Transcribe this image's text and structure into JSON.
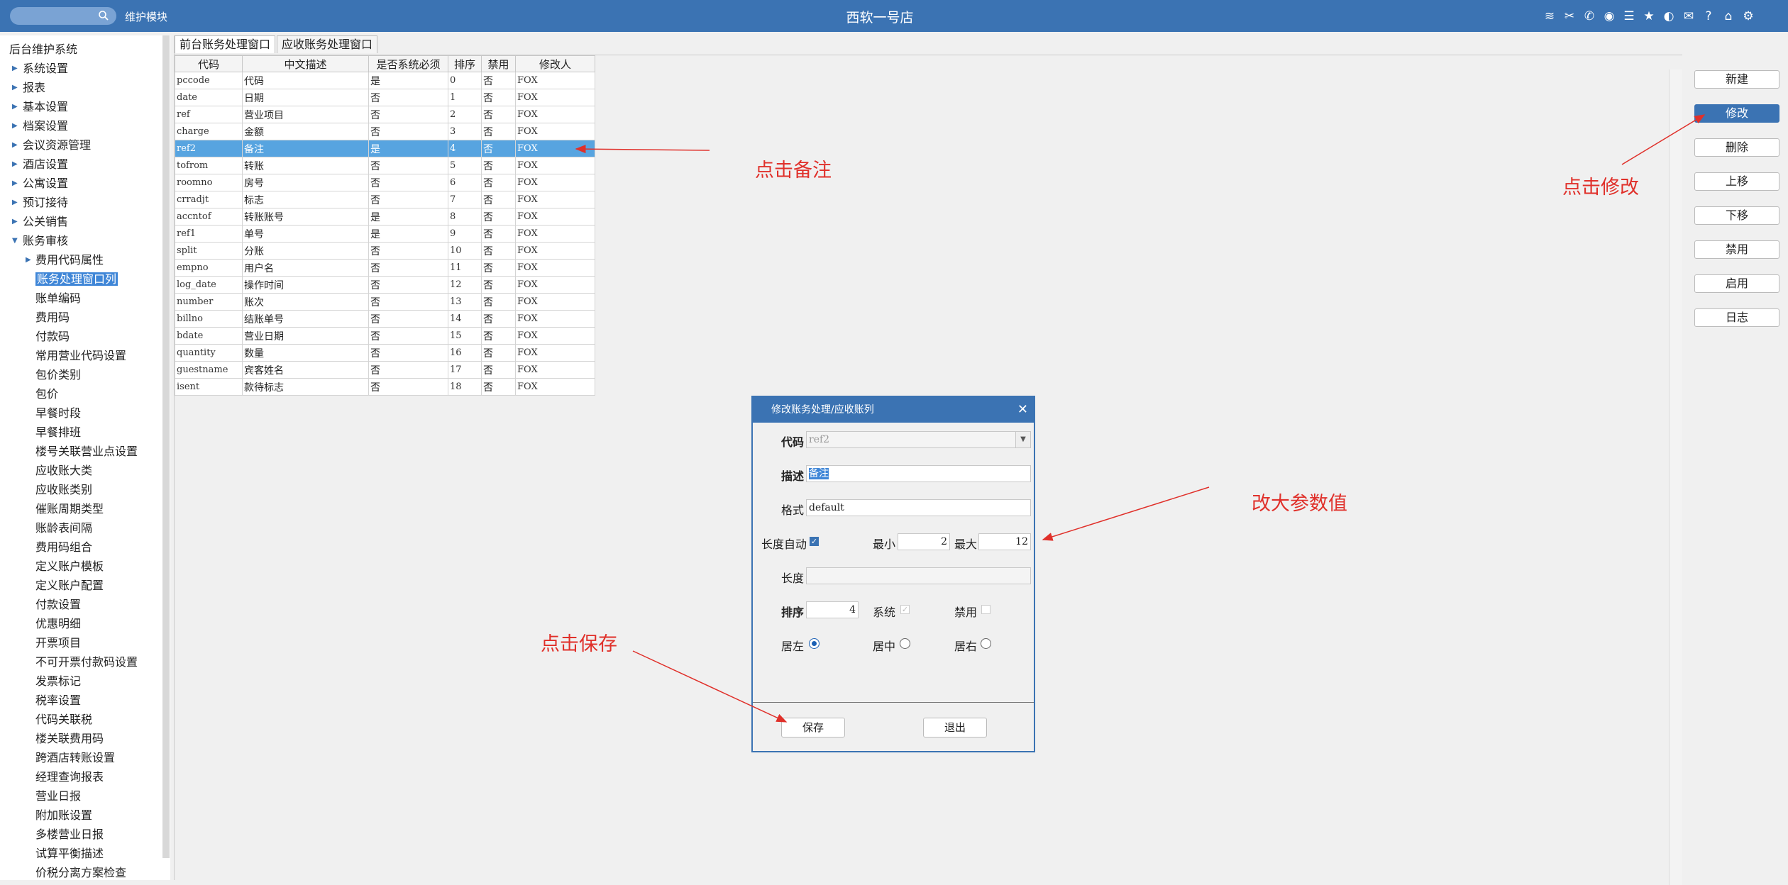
{
  "topbar": {
    "module": "维护模块",
    "title": "西软一号店"
  },
  "top_icons": [
    "wifi-icon",
    "tools-icon",
    "phone-icon",
    "palette-icon",
    "menu-icon",
    "star-icon",
    "contrast-icon",
    "mail-icon",
    "help-icon",
    "home-icon",
    "gear-icon"
  ],
  "sidebar": {
    "items": [
      {
        "label": "后台维护系统",
        "level": 0,
        "arrow": ""
      },
      {
        "label": "系统设置",
        "level": 1,
        "arrow": "▶"
      },
      {
        "label": "报表",
        "level": 1,
        "arrow": "▶"
      },
      {
        "label": "基本设置",
        "level": 1,
        "arrow": "▶"
      },
      {
        "label": "档案设置",
        "level": 1,
        "arrow": "▶"
      },
      {
        "label": "会议资源管理",
        "level": 1,
        "arrow": "▶"
      },
      {
        "label": "酒店设置",
        "level": 1,
        "arrow": "▶"
      },
      {
        "label": "公寓设置",
        "level": 1,
        "arrow": "▶"
      },
      {
        "label": "预订接待",
        "level": 1,
        "arrow": "▶"
      },
      {
        "label": "公关销售",
        "level": 1,
        "arrow": "▶"
      },
      {
        "label": "账务审核",
        "level": 1,
        "arrow": "▼"
      },
      {
        "label": "费用代码属性",
        "level": 2,
        "arrow": "▶"
      },
      {
        "label": "账务处理窗口列",
        "level": 2,
        "arrow": "",
        "selected": true
      },
      {
        "label": "账单编码",
        "level": 2,
        "arrow": ""
      },
      {
        "label": "费用码",
        "level": 2,
        "arrow": ""
      },
      {
        "label": "付款码",
        "level": 2,
        "arrow": ""
      },
      {
        "label": "常用营业代码设置",
        "level": 2,
        "arrow": ""
      },
      {
        "label": "包价类别",
        "level": 2,
        "arrow": ""
      },
      {
        "label": "包价",
        "level": 2,
        "arrow": ""
      },
      {
        "label": "早餐时段",
        "level": 2,
        "arrow": ""
      },
      {
        "label": "早餐排班",
        "level": 2,
        "arrow": ""
      },
      {
        "label": "楼号关联营业点设置",
        "level": 2,
        "arrow": ""
      },
      {
        "label": "应收账大类",
        "level": 2,
        "arrow": ""
      },
      {
        "label": "应收账类别",
        "level": 2,
        "arrow": ""
      },
      {
        "label": "催账周期类型",
        "level": 2,
        "arrow": ""
      },
      {
        "label": "账龄表间隔",
        "level": 2,
        "arrow": ""
      },
      {
        "label": "费用码组合",
        "level": 2,
        "arrow": ""
      },
      {
        "label": "定义账户模板",
        "level": 2,
        "arrow": ""
      },
      {
        "label": "定义账户配置",
        "level": 2,
        "arrow": ""
      },
      {
        "label": "付款设置",
        "level": 2,
        "arrow": ""
      },
      {
        "label": "优惠明细",
        "level": 2,
        "arrow": ""
      },
      {
        "label": "开票项目",
        "level": 2,
        "arrow": ""
      },
      {
        "label": "不可开票付款码设置",
        "level": 2,
        "arrow": ""
      },
      {
        "label": "发票标记",
        "level": 2,
        "arrow": ""
      },
      {
        "label": "税率设置",
        "level": 2,
        "arrow": ""
      },
      {
        "label": "代码关联税",
        "level": 2,
        "arrow": ""
      },
      {
        "label": "楼关联费用码",
        "level": 2,
        "arrow": ""
      },
      {
        "label": "跨酒店转账设置",
        "level": 2,
        "arrow": ""
      },
      {
        "label": "经理查询报表",
        "level": 2,
        "arrow": ""
      },
      {
        "label": "营业日报",
        "level": 2,
        "arrow": ""
      },
      {
        "label": "附加账设置",
        "level": 2,
        "arrow": ""
      },
      {
        "label": "多楼营业日报",
        "level": 2,
        "arrow": ""
      },
      {
        "label": "试算平衡描述",
        "level": 2,
        "arrow": ""
      },
      {
        "label": "价税分离方案检查",
        "level": 2,
        "arrow": ""
      }
    ]
  },
  "tabs": [
    "前台账务处理窗口",
    "应收账务处理窗口"
  ],
  "table": {
    "headers": [
      "代码",
      "中文描述",
      "是否系统必须",
      "排序",
      "禁用",
      "修改人"
    ],
    "rows": [
      [
        "pccode",
        "代码",
        "是",
        "0",
        "否",
        "FOX"
      ],
      [
        "date",
        "日期",
        "否",
        "1",
        "否",
        "FOX"
      ],
      [
        "ref",
        "营业项目",
        "否",
        "2",
        "否",
        "FOX"
      ],
      [
        "charge",
        "金额",
        "否",
        "3",
        "否",
        "FOX"
      ],
      [
        "ref2",
        "备注",
        "是",
        "4",
        "否",
        "FOX"
      ],
      [
        "tofrom",
        "转账",
        "否",
        "5",
        "否",
        "FOX"
      ],
      [
        "roomno",
        "房号",
        "否",
        "6",
        "否",
        "FOX"
      ],
      [
        "crradjt",
        "标志",
        "否",
        "7",
        "否",
        "FOX"
      ],
      [
        "accntof",
        "转账账号",
        "是",
        "8",
        "否",
        "FOX"
      ],
      [
        "ref1",
        "单号",
        "是",
        "9",
        "否",
        "FOX"
      ],
      [
        "split",
        "分账",
        "否",
        "10",
        "否",
        "FOX"
      ],
      [
        "empno",
        "用户名",
        "否",
        "11",
        "否",
        "FOX"
      ],
      [
        "log_date",
        "操作时间",
        "否",
        "12",
        "否",
        "FOX"
      ],
      [
        "number",
        "账次",
        "否",
        "13",
        "否",
        "FOX"
      ],
      [
        "billno",
        "结账单号",
        "否",
        "14",
        "否",
        "FOX"
      ],
      [
        "bdate",
        "营业日期",
        "否",
        "15",
        "否",
        "FOX"
      ],
      [
        "quantity",
        "数量",
        "否",
        "16",
        "否",
        "FOX"
      ],
      [
        "guestname",
        "宾客姓名",
        "否",
        "17",
        "否",
        "FOX"
      ],
      [
        "isent",
        "款待标志",
        "否",
        "18",
        "否",
        "FOX"
      ]
    ],
    "selected_row": 4
  },
  "right_buttons": [
    "新建",
    "修改",
    "删除",
    "上移",
    "下移",
    "禁用",
    "启用",
    "日志"
  ],
  "active_right_button": 1,
  "dialog": {
    "title": "修改账务处理/应收账列",
    "code_label": "代码",
    "code_value": "ref2",
    "desc_label": "描述",
    "desc_value": "备注",
    "format_label": "格式",
    "format_value": "default",
    "auto_len_label": "长度自动",
    "auto_len_checked": true,
    "min_label": "最小",
    "min_value": "2",
    "max_label": "最大",
    "max_value": "12",
    "length_label": "长度",
    "length_value": "",
    "sort_label": "排序",
    "sort_value": "4",
    "system_label": "系统",
    "system_checked": true,
    "disable_label": "禁用",
    "disable_checked": false,
    "align_left_label": "居左",
    "align_center_label": "居中",
    "align_right_label": "居右",
    "align_selected": "left",
    "save_label": "保存",
    "exit_label": "退出"
  },
  "annotations": {
    "click_remark": "点击备注",
    "click_modify": "点击修改",
    "enlarge_param": "改大参数值",
    "click_save": "点击保存"
  },
  "colors": {
    "accent": "#3b73b3",
    "selection": "#57a4e0",
    "annotation": "#e0302a"
  }
}
